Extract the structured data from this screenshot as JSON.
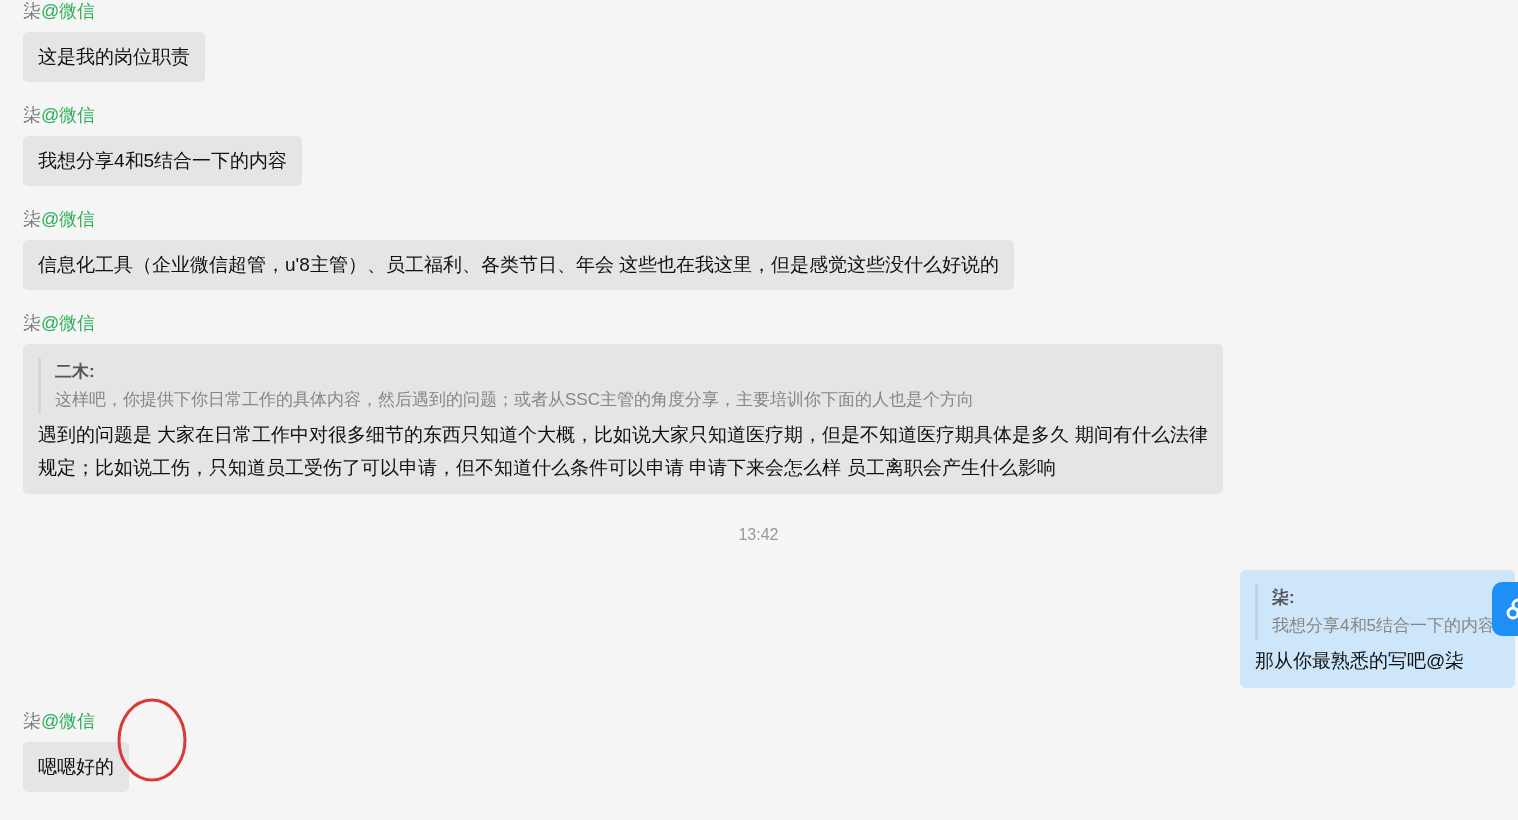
{
  "messages": [
    {
      "kind": "incoming",
      "sender": "柒",
      "source": "@微信",
      "text": "这是我的岗位职责",
      "circled": false
    },
    {
      "kind": "incoming",
      "sender": "柒",
      "source": "@微信",
      "text": "我想分享4和5结合一下的内容",
      "circled": false
    },
    {
      "kind": "incoming",
      "sender": "柒",
      "source": "@微信",
      "text": "信息化工具（企业微信超管，u'8主管）、员工福利、各类节日、年会  这些也在我这里，但是感觉这些没什么好说的",
      "circled": false
    },
    {
      "kind": "incoming",
      "sender": "柒",
      "source": "@微信",
      "quote": {
        "author": "二木:",
        "text": "这样吧，你提供下你日常工作的具体内容，然后遇到的问题；或者从SSC主管的角度分享，主要培训你下面的人也是个方向"
      },
      "text": "遇到的问题是  大家在日常工作中对很多细节的东西只知道个大概，比如说大家只知道医疗期，但是不知道医疗期具体是多久 期间有什么法律规定；比如说工伤，只知道员工受伤了可以申请，但不知道什么条件可以申请 申请下来会怎么样 员工离职会产生什么影响",
      "circled": false
    },
    {
      "kind": "time",
      "text": "13:42"
    },
    {
      "kind": "outgoing",
      "quote": {
        "author": "柒:",
        "text": "我想分享4和5结合一下的内容"
      },
      "text": "那从你最熟悉的写吧@柒"
    },
    {
      "kind": "incoming",
      "sender": "柒",
      "source": "@微信",
      "text": "嗯嗯好的",
      "circled": true
    }
  ]
}
